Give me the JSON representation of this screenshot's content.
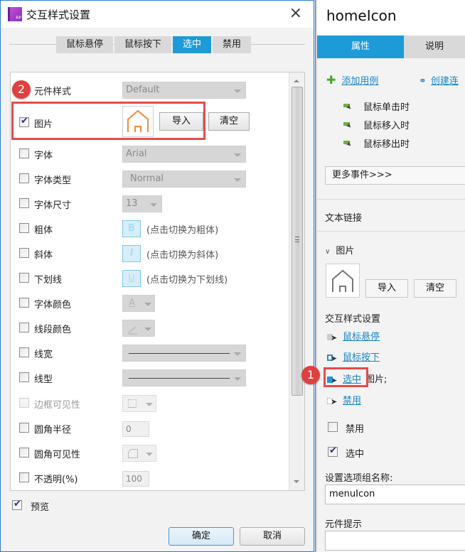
{
  "dialog": {
    "title": "交互样式设置",
    "close_icon": "×",
    "tabs": [
      {
        "label": "鼠标悬停",
        "active": false
      },
      {
        "label": "鼠标按下",
        "active": false
      },
      {
        "label": "选中",
        "active": true
      },
      {
        "label": "禁用",
        "active": false
      }
    ],
    "rows": {
      "widget_style": {
        "label": "元件样式",
        "value": "Default",
        "checked": false
      },
      "image": {
        "label": "图片",
        "checked": true,
        "import_label": "导入",
        "clear_label": "清空"
      },
      "font": {
        "label": "字体",
        "value": "Arial",
        "checked": false
      },
      "font_type": {
        "label": "字体类型",
        "value": "Normal",
        "checked": false
      },
      "font_size": {
        "label": "字体尺寸",
        "value": "13",
        "checked": false
      },
      "bold": {
        "label": "粗体",
        "button": "B",
        "hint": "(点击切换为粗体)",
        "checked": false
      },
      "italic": {
        "label": "斜体",
        "button": "I",
        "hint": "(点击切换为斜体)",
        "checked": false
      },
      "underline": {
        "label": "下划线",
        "button": "U",
        "hint": "(点击切换为下划线)",
        "checked": false
      },
      "font_color": {
        "label": "字体颜色",
        "button": "A",
        "checked": false
      },
      "line_color": {
        "label": "线段颜色",
        "checked": false
      },
      "line_width": {
        "label": "线宽",
        "checked": false
      },
      "line_style": {
        "label": "线型",
        "checked": false
      },
      "border_visibility": {
        "label": "边框可见性",
        "checked": false,
        "disabled": true
      },
      "corner_radius": {
        "label": "圆角半径",
        "value": "0",
        "checked": false
      },
      "corner_visibility": {
        "label": "圆角可见性",
        "checked": false
      },
      "opacity": {
        "label": "不透明(%)",
        "value": "100",
        "checked": false
      }
    },
    "preview": {
      "label": "预览",
      "checked": true
    },
    "ok_label": "确定",
    "cancel_label": "取消",
    "badge_2": "2"
  },
  "right_panel": {
    "title": "homeIcon",
    "tabs": [
      {
        "label": "属性",
        "active": true
      },
      {
        "label": "说明",
        "active": false
      }
    ],
    "add_case_label": "添加用例",
    "create_link_label": "创建连",
    "events": [
      "鼠标单击时",
      "鼠标移入时",
      "鼠标移出时"
    ],
    "more_events_label": "更多事件>>>",
    "text_link_label": "文本链接",
    "image_section_label": "图片",
    "import_label": "导入",
    "clear_label": "清空",
    "interaction_styles_label": "交互样式设置",
    "styles": [
      {
        "label": "鼠标悬停",
        "suffix": ""
      },
      {
        "label": "鼠标按下",
        "suffix": ""
      },
      {
        "label": "选中",
        "suffix": "图片;"
      },
      {
        "label": "禁用",
        "suffix": ""
      }
    ],
    "disabled_checkbox": {
      "label": "禁用",
      "checked": false
    },
    "selected_checkbox": {
      "label": "选中",
      "checked": true
    },
    "group_name_label": "设置选项组名称:",
    "group_name_value": "menuIcon",
    "tooltip_label": "元件提示",
    "tooltip_value": "",
    "badge_1": "1"
  },
  "colors": {
    "accent": "#1e9bd7",
    "highlight_red": "#e44b4b",
    "image_orange": "#f58a3c",
    "event_green": "#6cb33e",
    "link_blue": "#1b86c5"
  }
}
